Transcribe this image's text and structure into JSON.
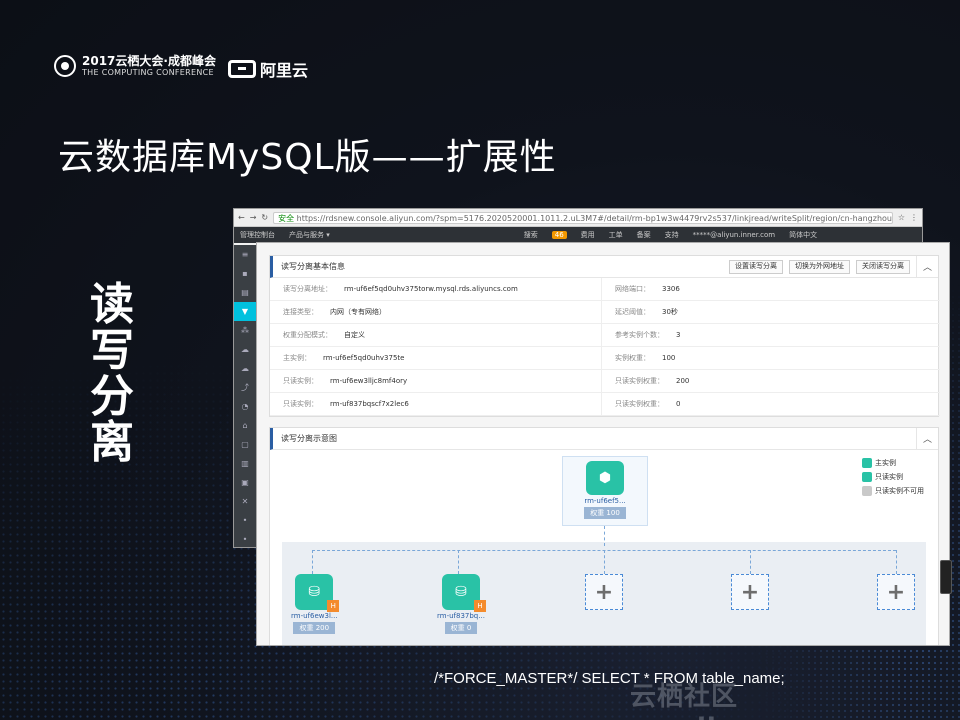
{
  "conference": {
    "name": "2017云栖大会·成都峰会",
    "subtitle": "THE COMPUTING CONFERENCE",
    "partner": "阿里云"
  },
  "slide": {
    "title": "云数据库MySQL版——扩展性",
    "side_label": "读写分离",
    "sql_hint": "/*FORCE_MASTER*/ SELECT * FROM table_name;",
    "watermark": "云栖社区 yq.aliyun.com"
  },
  "browser": {
    "secure_label": "安全",
    "url": "https://rdsnew.console.aliyun.com/?spm=5176.2020520001.1011.2.uL3M7#/detail/rm-bp1w3w4479rv2s537/linkjread/writeSplit/region/cn-hangzhou",
    "console_home": "管理控制台",
    "products_menu": "产品与服务 ▾",
    "search": "搜索",
    "badge": "46",
    "menu_items": [
      "费用",
      "工单",
      "备案",
      "支持"
    ],
    "account": "*****@aliyun.inner.com",
    "lang": "简体中文"
  },
  "panel": {
    "basic_info": {
      "title": "读写分离基本信息",
      "buttons": [
        "设置读写分离",
        "切换为外网地址",
        "关闭读写分离"
      ],
      "rows": [
        {
          "key": "读写分离地址：",
          "value": "rm-uf6ef5qd0uhv375torw.mysql.rds.aliyuncs.com",
          "key2": "网络端口：",
          "value2": "3306"
        },
        {
          "key": "连接类型：",
          "value": "内网（专有网络）",
          "key2": "延迟阈值：",
          "value2": "30秒"
        },
        {
          "key": "权重分配模式：",
          "value": "自定义",
          "key2": "参考实例个数：",
          "value2": "3"
        },
        {
          "key": "主实例：",
          "value": "rm-uf6ef5qd0uhv375te",
          "key2": "实例权重：",
          "value2": "100"
        },
        {
          "key": "只读实例：",
          "value": "rm-uf6ew3lljc8mf4ory",
          "key2": "只读实例权重：",
          "value2": "200"
        },
        {
          "key": "只读实例：",
          "value": "rm-uf837bqscf7x2lec6",
          "key2": "只读实例权重：",
          "value2": "0"
        }
      ]
    },
    "diagram": {
      "title": "读写分离示意图",
      "master": {
        "name": "rm-uf6ef5...",
        "weight": "权重 100"
      },
      "legend": [
        "主实例",
        "只读实例",
        "只读实例不可用"
      ],
      "readonly": [
        {
          "name": "rm-uf6ew3l...",
          "weight": "权重 200"
        },
        {
          "name": "rm-uf837bq...",
          "weight": "权重 0"
        }
      ],
      "add_symbol": "+",
      "h_tag": "H"
    }
  },
  "colors": {
    "accent": "#00c1de",
    "node": "#29c2a6",
    "h_badge": "#f48b2c",
    "header_bar": "#2a5ea3"
  }
}
